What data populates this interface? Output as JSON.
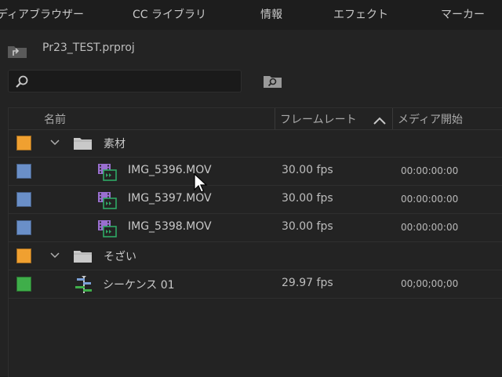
{
  "tabs": [
    {
      "label": "ディアブラウザー"
    },
    {
      "label": "CC ライブラリ"
    },
    {
      "label": "情報"
    },
    {
      "label": "エフェクト"
    },
    {
      "label": "マーカー"
    }
  ],
  "project": {
    "name": "Pr23_TEST.prproj"
  },
  "search": {
    "placeholder": "",
    "value": ""
  },
  "columns": {
    "name": "名前",
    "frame_rate": "フレームレート",
    "media_start": "メディア開始"
  },
  "colors": {
    "orange": "#f0a030",
    "blue": "#6a8fc8",
    "green": "#3fae4a",
    "clip_icon": "#9a6fd0",
    "clip_icon_accent": "#2fa866"
  },
  "rows": [
    {
      "type": "folder",
      "name": "素材",
      "label_color": "#f0a030",
      "expanded": true,
      "frame_rate": "",
      "media_start": ""
    },
    {
      "type": "clip",
      "name": "IMG_5396.MOV",
      "label_color": "#6a8fc8",
      "frame_rate": "30.00 fps",
      "media_start": "00:00:00:00"
    },
    {
      "type": "clip",
      "name": "IMG_5397.MOV",
      "label_color": "#6a8fc8",
      "frame_rate": "30.00 fps",
      "media_start": "00:00:00:00"
    },
    {
      "type": "clip",
      "name": "IMG_5398.MOV",
      "label_color": "#6a8fc8",
      "frame_rate": "30.00 fps",
      "media_start": "00:00:00:00"
    },
    {
      "type": "folder",
      "name": "そざい",
      "label_color": "#f0a030",
      "expanded": true,
      "frame_rate": "",
      "media_start": ""
    },
    {
      "type": "sequence",
      "name": "シーケンス 01",
      "label_color": "#3fae4a",
      "frame_rate": "29.97 fps",
      "media_start": "00;00;00;00"
    }
  ]
}
